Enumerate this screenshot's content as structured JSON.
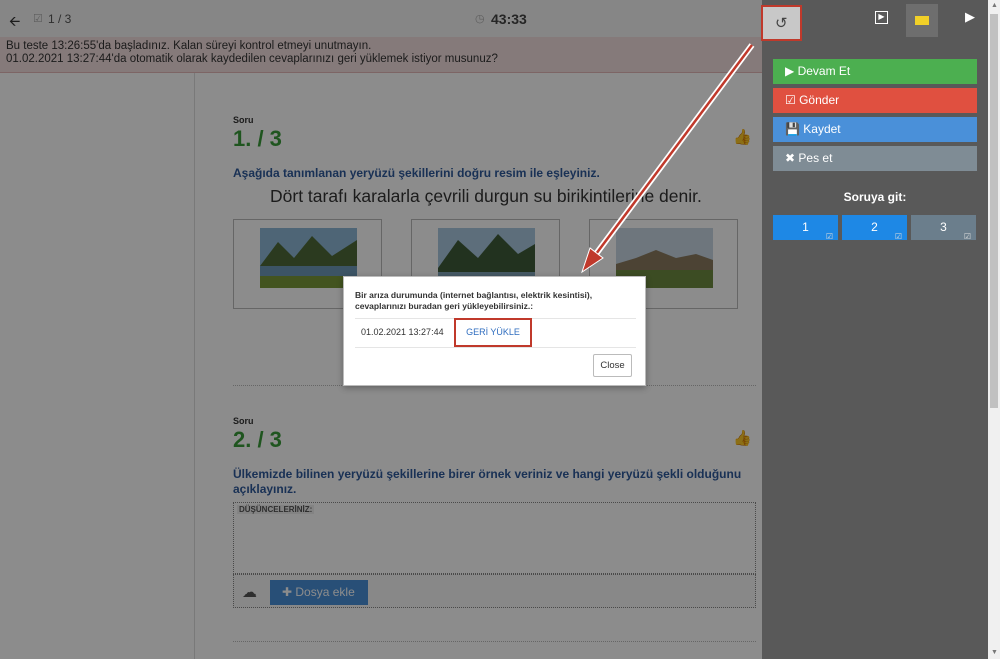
{
  "topbar": {
    "back_icon": "arrow-left-icon",
    "progress": "1 / 3",
    "timer": "43:33"
  },
  "alert": {
    "line1": "Bu teste 13:26:55'da başladınız. Kalan süreyi kontrol etmeyi unutmayın.",
    "line2": "01.02.2021 13:27:44'da otomatik olarak kaydedilen cevaplarınızı geri yüklemek istiyor musunuz?"
  },
  "questions": [
    {
      "label": "Soru",
      "number": "1. / 3",
      "prompt": "Aşağıda tanımlanan yeryüzü şekillerini doğru resim ile eşleyiniz.",
      "sentence": "Dört tarafı karalarla çevrili durgun su birikintilerine denir."
    },
    {
      "label": "Soru",
      "number": "2. / 3",
      "prompt": "Ülkemizde bilinen yeryüzü şekillerine birer örnek veriniz ve hangi yeryüzü şekli olduğunu açıklayınız.",
      "textarea_label": "DÜŞÜNCELERİNİZ:",
      "attach_label": "Dosya ekle"
    }
  ],
  "panel": {
    "actions": [
      {
        "label": "Devam Et",
        "color": "#4caf50"
      },
      {
        "label": "Gönder",
        "color": "#e05040"
      },
      {
        "label": "Kaydet",
        "color": "#4a90d9"
      },
      {
        "label": "Pes et",
        "color": "#7f8c95"
      }
    ],
    "goto_label": "Soruya git:",
    "question_buttons": [
      {
        "label": "1",
        "color": "#1e88e5"
      },
      {
        "label": "2",
        "color": "#1e88e5"
      },
      {
        "label": "3",
        "color": "#6b7e8c"
      }
    ]
  },
  "modal": {
    "message": "Bir arıza durumunda (internet bağlantısı, elektrik kesintisi), cevaplarınızı buradan geri yükleyebilirsiniz.:",
    "date": "01.02.2021 13:27:44",
    "restore_label": "GERİ YÜKLE",
    "close_label": "Close"
  }
}
